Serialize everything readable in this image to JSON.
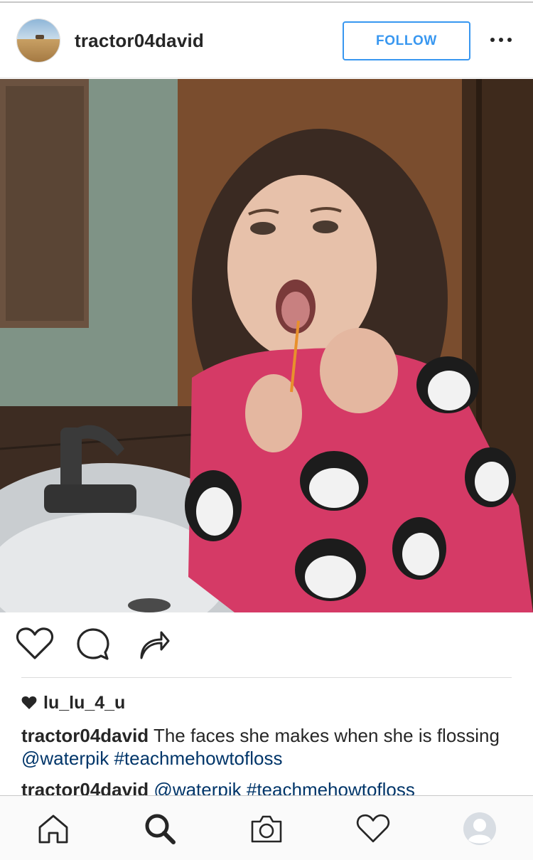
{
  "post": {
    "username": "tractor04david",
    "follow_label": "FOLLOW",
    "more_icon": "ellipsis-icon",
    "photo_description_icon": "photo"
  },
  "actions": {
    "like_icon": "heart-icon",
    "comment_icon": "comment-icon",
    "share_icon": "share-icon"
  },
  "likes": {
    "liker": "lu_lu_4_u"
  },
  "caption": {
    "username": "tractor04david",
    "text": "The faces she makes when she is flossing",
    "mention": "@waterpik",
    "hashtag": "#teachmehowtofloss"
  },
  "comment": {
    "username": "tractor04david",
    "mention": "@waterpik",
    "hashtag": "#teachmehowtofloss"
  },
  "tabbar": {
    "items": [
      {
        "icon": "home-icon"
      },
      {
        "icon": "search-icon"
      },
      {
        "icon": "camera-icon"
      },
      {
        "icon": "activity-heart-icon"
      },
      {
        "icon": "profile-icon"
      }
    ]
  },
  "colors": {
    "link": "#003569",
    "follow": "#3897f0",
    "text": "#262626"
  }
}
